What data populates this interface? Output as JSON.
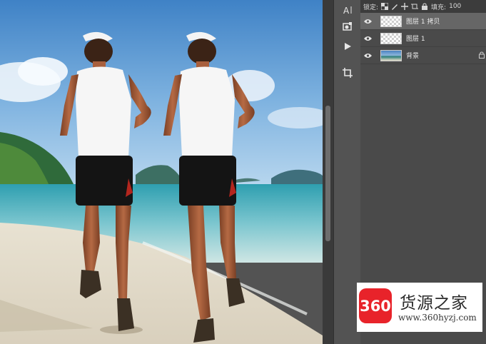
{
  "toolbar": {
    "lock_label": "锁定:",
    "fill_label": "填充:",
    "fill_value": "100"
  },
  "layers": [
    {
      "name": "图层 1 拷贝",
      "selected": true,
      "visible": true,
      "thumb": "transparent"
    },
    {
      "name": "图层 1",
      "selected": false,
      "visible": true,
      "thumb": "transparent"
    },
    {
      "name": "背景",
      "selected": false,
      "visible": true,
      "thumb": "photo",
      "locked": true
    }
  ],
  "tools": [
    "text-tool-icon",
    "3d-object-icon",
    "play-icon",
    "crop-icon"
  ],
  "watermark": {
    "badge": "360",
    "title": "货源之家",
    "url": "www.360hyzj.com"
  },
  "colors": {
    "panel": "#535353",
    "layers_bg": "#4a4a4a",
    "selected_row": "#666666",
    "badge": "#e8232a"
  }
}
